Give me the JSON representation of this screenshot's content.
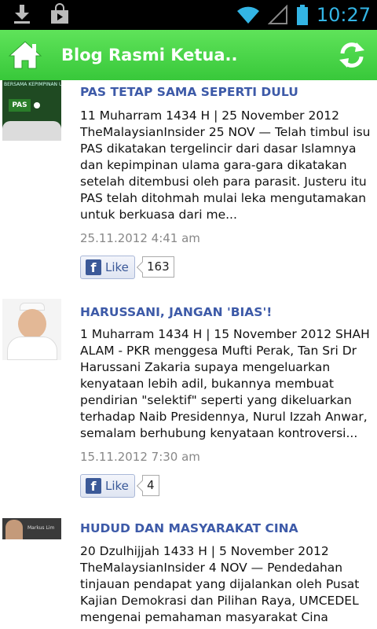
{
  "status_bar": {
    "time": "10:27",
    "icons": [
      "download-icon",
      "shopping-bag-icon",
      "wifi-icon",
      "signal-icon",
      "battery-icon"
    ]
  },
  "action_bar": {
    "title": "Blog Rasmi Ketua..",
    "home_icon": "home-icon",
    "refresh_icon": "refresh-icon",
    "color": "#4ad84a"
  },
  "posts": [
    {
      "title": "PAS TETAP SAMA SEPERTI DULU",
      "body": "11 Muharram 1434 H | 25 November 2012 TheMalaysianInsider 25 NOV — Telah timbul isu PAS dikatakan tergelincir dari dasar Islamnya dan kepimpinan ulama gara-gara dikatakan setelah ditembusi oleh para parasit. Justeru itu PAS telah ditohmah mulai leka mengutamakan untuk berkuasa dari me...",
      "date": "25.11.2012 4:41 am",
      "like_label": "Like",
      "like_count": "163",
      "thumb_text": "BERSAMA KEPIMPINAN ULAMA",
      "thumb_logo": "PAS"
    },
    {
      "title": "HARUSSANI, JANGAN 'BIAS'!",
      "body": "1 Muharram 1434 H | 15 November 2012 SHAH ALAM - PKR menggesa Mufti Perak, Tan Sri Dr Harussani Zakaria supaya mengeluarkan kenyataan lebih adil, bukannya membuat pendirian \"selektif\" seperti yang dikeluarkan terhadap Naib Presidennya, Nurul Izzah Anwar, semalam berhubung kenyataan kontroversi...",
      "date": "15.11.2012 7:30 am",
      "like_label": "Like",
      "like_count": "4"
    },
    {
      "title": "HUDUD DAN MASYARAKAT CINA",
      "body": "20 Dzulhijjah 1433 H | 5 November 2012 TheMalaysianInsider 4 NOV — Pendedahan tinjauan pendapat yang dijalankan oleh Pusat Kajian Demokrasi dan Pilihan Raya, UMCEDEL mengenai pemahaman masyarakat Cina",
      "thumb_text": "Markus Lim"
    }
  ]
}
